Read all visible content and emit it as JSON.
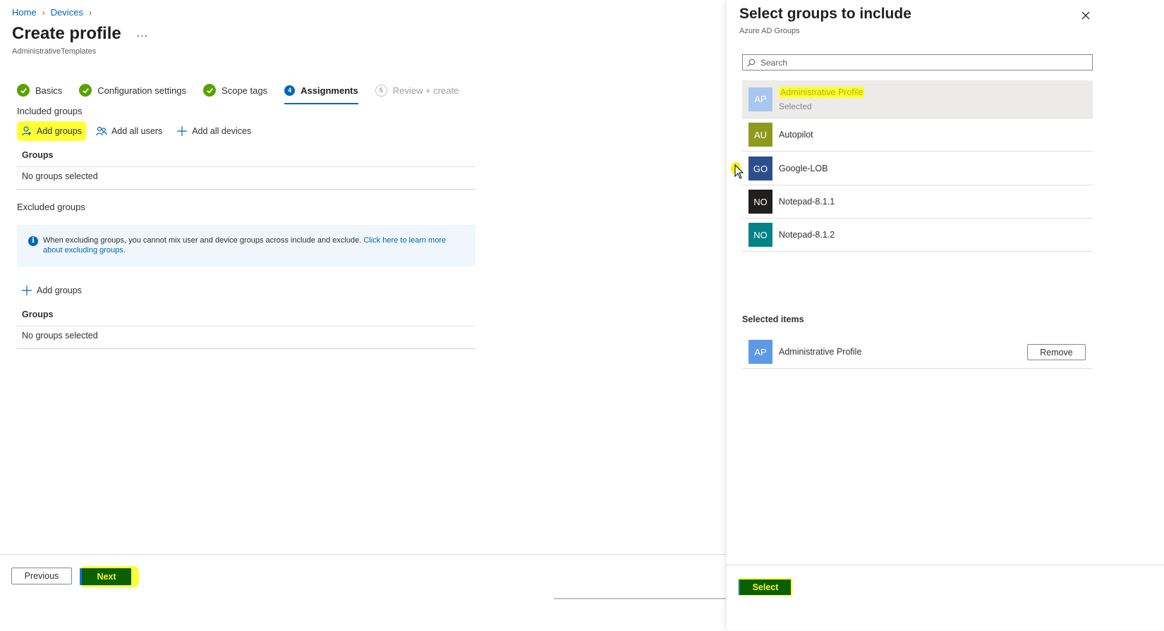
{
  "breadcrumb": {
    "home": "Home",
    "devices": "Devices",
    "sep": ">"
  },
  "page": {
    "title": "Create profile",
    "more": "...",
    "subtitle": "AdministrativeTemplates"
  },
  "wizard": {
    "steps": [
      {
        "label": "Basics",
        "state": "done"
      },
      {
        "label": "Configuration settings",
        "state": "done"
      },
      {
        "label": "Scope tags",
        "state": "done"
      },
      {
        "label": "Assignments",
        "state": "active",
        "number": "4"
      },
      {
        "label": "Review + create",
        "state": "disabled",
        "number": "5"
      }
    ]
  },
  "included": {
    "label": "Included groups",
    "add_groups": "Add groups",
    "add_all_users": "Add all users",
    "add_all_devices": "Add all devices",
    "table_header": "Groups",
    "empty": "No groups selected"
  },
  "excluded": {
    "label": "Excluded groups",
    "info_text": "When excluding groups, you cannot mix user and device groups across include and exclude.",
    "info_link": "Click here to learn more about excluding groups.",
    "add_groups": "Add groups",
    "table_header": "Groups",
    "empty": "No groups selected"
  },
  "footer": {
    "previous": "Previous",
    "next": "Next"
  },
  "pane": {
    "title": "Select groups to include",
    "subtitle": "Azure AD Groups",
    "search_placeholder": "Search",
    "groups": [
      {
        "initials": "AP",
        "name": "Administrative Profile",
        "sub": "Selected",
        "color": "#a9c6ee",
        "selected": true
      },
      {
        "initials": "AU",
        "name": "Autopilot",
        "color": "#8c9a1f"
      },
      {
        "initials": "GO",
        "name": "Google-LOB",
        "color": "#2b4f8c"
      },
      {
        "initials": "NO",
        "name": "Notepad-8.1.1",
        "color": "#201f1e"
      },
      {
        "initials": "NO",
        "name": "Notepad-8.1.2",
        "color": "#038387"
      }
    ],
    "selected_label": "Selected items",
    "selected_item": {
      "initials": "AP",
      "name": "Administrative Profile",
      "color": "#5c9ae6"
    },
    "remove": "Remove",
    "select": "Select"
  }
}
